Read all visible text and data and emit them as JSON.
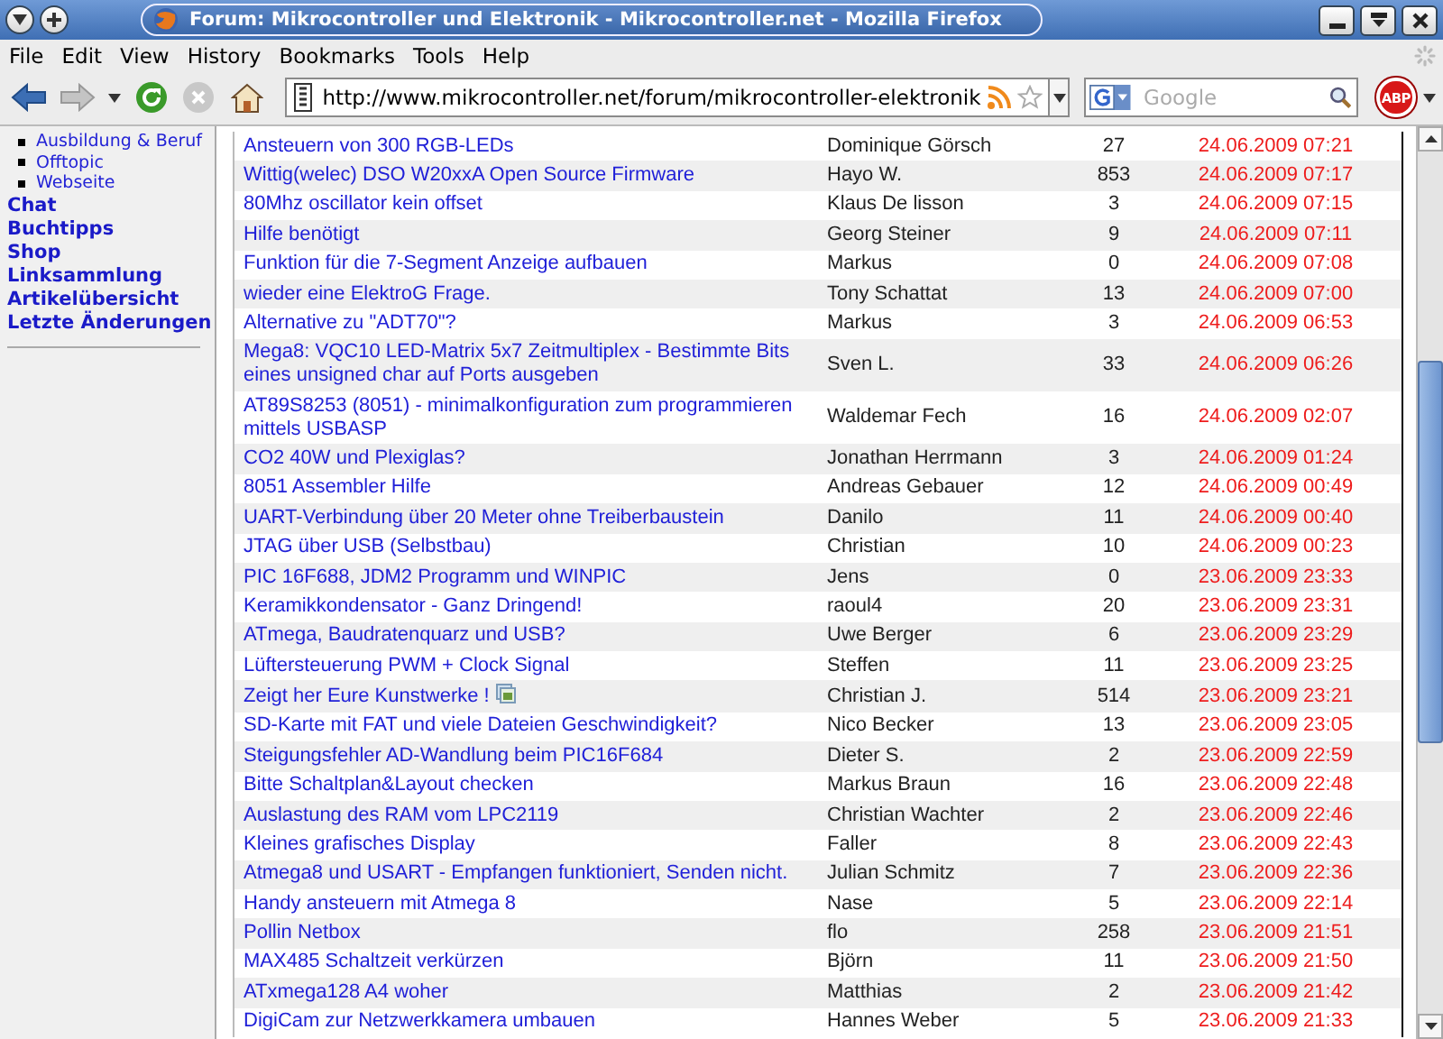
{
  "window": {
    "title": "Forum: Mikrocontroller und Elektronik - Mikrocontroller.net - Mozilla Firefox"
  },
  "menu": [
    "File",
    "Edit",
    "View",
    "History",
    "Bookmarks",
    "Tools",
    "Help"
  ],
  "toolbar": {
    "url": "http://www.mikrocontroller.net/forum/mikrocontroller-elektronik",
    "search_placeholder": "Google",
    "adblock_label": "ABP"
  },
  "sidebar": {
    "subitems": [
      "Ausbildung & Beruf",
      "Offtopic",
      "Webseite"
    ],
    "links": [
      "Chat",
      "Buchtipps",
      "Shop",
      "Linksammlung",
      "Artikelübersicht",
      "Letzte Änderungen"
    ]
  },
  "threads": [
    {
      "title": "Ansteuern von 300 RGB-LEDs",
      "author": "Dominique Görsch",
      "replies": "27",
      "date": "24.06.2009 07:21",
      "image_icon": false
    },
    {
      "title": "Wittig(welec) DSO W20xxA Open Source Firmware",
      "author": "Hayo W.",
      "replies": "853",
      "date": "24.06.2009 07:17",
      "image_icon": false
    },
    {
      "title": "80Mhz oscillator kein offset",
      "author": "Klaus De lisson",
      "replies": "3",
      "date": "24.06.2009 07:15",
      "image_icon": false
    },
    {
      "title": "Hilfe benötigt",
      "author": "Georg Steiner",
      "replies": "9",
      "date": "24.06.2009 07:11",
      "image_icon": false
    },
    {
      "title": "Funktion für die 7-Segment Anzeige aufbauen",
      "author": "Markus",
      "replies": "0",
      "date": "24.06.2009 07:08",
      "image_icon": false
    },
    {
      "title": "wieder eine ElektroG Frage.",
      "author": "Tony Schattat",
      "replies": "13",
      "date": "24.06.2009 07:00",
      "image_icon": false
    },
    {
      "title": "Alternative zu \"ADT70\"?",
      "author": "Markus",
      "replies": "3",
      "date": "24.06.2009 06:53",
      "image_icon": false
    },
    {
      "title": "Mega8: VQC10 LED-Matrix 5x7 Zeitmultiplex - Bestimmte Bits eines unsigned char auf Ports ausgeben",
      "author": "Sven L.",
      "replies": "33",
      "date": "24.06.2009 06:26",
      "image_icon": false
    },
    {
      "title": "AT89S8253 (8051) - minimalkonfiguration zum programmieren mittels USBASP",
      "author": "Waldemar Fech",
      "replies": "16",
      "date": "24.06.2009 02:07",
      "image_icon": false
    },
    {
      "title": "CO2 40W und Plexiglas?",
      "author": "Jonathan Herrmann",
      "replies": "3",
      "date": "24.06.2009 01:24",
      "image_icon": false
    },
    {
      "title": "8051 Assembler Hilfe",
      "author": "Andreas Gebauer",
      "replies": "12",
      "date": "24.06.2009 00:49",
      "image_icon": false
    },
    {
      "title": "UART-Verbindung über 20 Meter ohne Treiberbaustein",
      "author": "Danilo",
      "replies": "11",
      "date": "24.06.2009 00:40",
      "image_icon": false
    },
    {
      "title": "JTAG über USB (Selbstbau)",
      "author": "Christian",
      "replies": "10",
      "date": "24.06.2009 00:23",
      "image_icon": false
    },
    {
      "title": "PIC 16F688, JDM2 Programm und WINPIC",
      "author": "Jens",
      "replies": "0",
      "date": "23.06.2009 23:33",
      "image_icon": false
    },
    {
      "title": "Keramikkondensator - Ganz Dringend!",
      "author": "raoul4",
      "replies": "20",
      "date": "23.06.2009 23:31",
      "image_icon": false
    },
    {
      "title": "ATmega, Baudratenquarz und USB?",
      "author": "Uwe Berger",
      "replies": "6",
      "date": "23.06.2009 23:29",
      "image_icon": false
    },
    {
      "title": "Lüftersteuerung PWM + Clock Signal",
      "author": "Steffen",
      "replies": "11",
      "date": "23.06.2009 23:25",
      "image_icon": false
    },
    {
      "title": "Zeigt her Eure Kunstwerke !",
      "author": "Christian J.",
      "replies": "514",
      "date": "23.06.2009 23:21",
      "image_icon": true
    },
    {
      "title": "SD-Karte mit FAT und viele Dateien Geschwindigkeit?",
      "author": "Nico Becker",
      "replies": "13",
      "date": "23.06.2009 23:05",
      "image_icon": false
    },
    {
      "title": "Steigungsfehler AD-Wandlung beim PIC16F684",
      "author": "Dieter S.",
      "replies": "2",
      "date": "23.06.2009 22:59",
      "image_icon": false
    },
    {
      "title": "Bitte Schaltplan&Layout checken",
      "author": "Markus Braun",
      "replies": "16",
      "date": "23.06.2009 22:48",
      "image_icon": false
    },
    {
      "title": "Auslastung des RAM vom LPC2119",
      "author": "Christian Wachter",
      "replies": "2",
      "date": "23.06.2009 22:46",
      "image_icon": false
    },
    {
      "title": "Kleines grafisches Display",
      "author": "Faller",
      "replies": "8",
      "date": "23.06.2009 22:43",
      "image_icon": false
    },
    {
      "title": "Atmega8 und USART - Empfangen funktioniert, Senden nicht.",
      "author": "Julian Schmitz",
      "replies": "7",
      "date": "23.06.2009 22:36",
      "image_icon": false
    },
    {
      "title": "Handy ansteuern mit Atmega 8",
      "author": "Nase",
      "replies": "5",
      "date": "23.06.2009 22:14",
      "image_icon": false
    },
    {
      "title": "Pollin Netbox",
      "author": "flo",
      "replies": "258",
      "date": "23.06.2009 21:51",
      "image_icon": false
    },
    {
      "title": "MAX485 Schaltzeit verkürzen",
      "author": "Björn",
      "replies": "11",
      "date": "23.06.2009 21:50",
      "image_icon": false
    },
    {
      "title": "ATxmega128 A4 woher",
      "author": "Matthias",
      "replies": "2",
      "date": "23.06.2009 21:42",
      "image_icon": false
    },
    {
      "title": "DigiCam zur Netzwerkkamera umbauen",
      "author": "Hannes Weber",
      "replies": "5",
      "date": "23.06.2009 21:33",
      "image_icon": false
    }
  ]
}
